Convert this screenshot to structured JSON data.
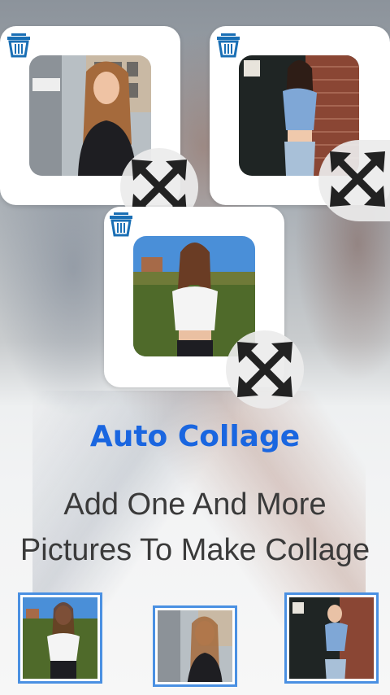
{
  "screen": {
    "title": "Auto Collage",
    "description": "Add One And More Pictures To Make Collage"
  },
  "colors": {
    "title": "#1a66e0",
    "description": "#3a3a3a",
    "thumb_border": "#4a90e2",
    "trash": "#1a6fb5"
  },
  "collage_tiles": [
    {
      "name": "tile-1",
      "photo": "girl-street-pole",
      "delete_icon": "trash-icon",
      "handle_icon": "resize-arrows-icon"
    },
    {
      "name": "tile-2",
      "photo": "girl-brick-wall",
      "delete_icon": "trash-icon",
      "handle_icon": "resize-arrows-icon"
    },
    {
      "name": "tile-3",
      "photo": "girl-white-top-park",
      "delete_icon": "trash-icon",
      "handle_icon": "resize-arrows-icon"
    }
  ],
  "thumbnails": [
    {
      "photo": "girl-white-top-park"
    },
    {
      "photo": "girl-street-pole"
    },
    {
      "photo": "girl-brick-wall"
    }
  ]
}
